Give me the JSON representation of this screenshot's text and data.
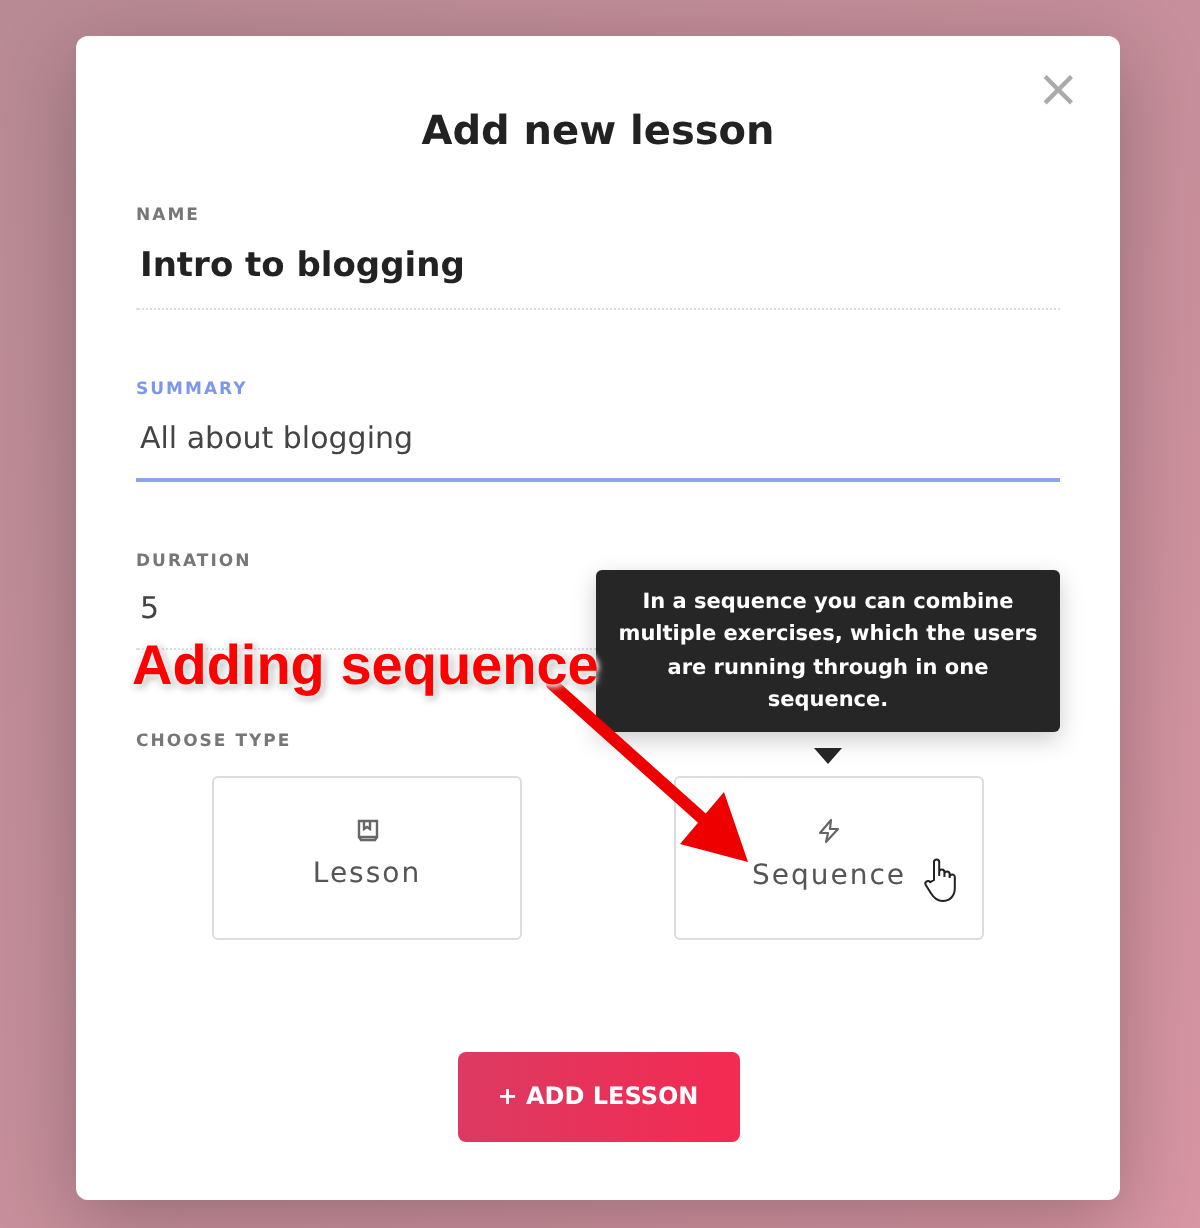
{
  "dialog": {
    "title": "Add new lesson",
    "close": "×"
  },
  "fields": [
    {
      "label": "NAME",
      "value": "Intro to blogging",
      "focused": false,
      "bold": true
    },
    {
      "label": "SUMMARY",
      "value": "All about blogging",
      "focused": true,
      "bold": false
    },
    {
      "label": "DURATION",
      "value": "5",
      "focused": false,
      "bold": false
    }
  ],
  "type_section": {
    "label": "CHOOSE TYPE",
    "options": [
      {
        "kind": "lesson",
        "label": "Lesson"
      },
      {
        "kind": "sequence",
        "label": "Sequence"
      }
    ]
  },
  "tooltip": {
    "text": "In a sequence you can combine multiple exercises, which the users are running through in one sequence."
  },
  "annotation": {
    "text": "Adding sequence"
  },
  "submit": {
    "label": "+ ADD LESSON"
  }
}
